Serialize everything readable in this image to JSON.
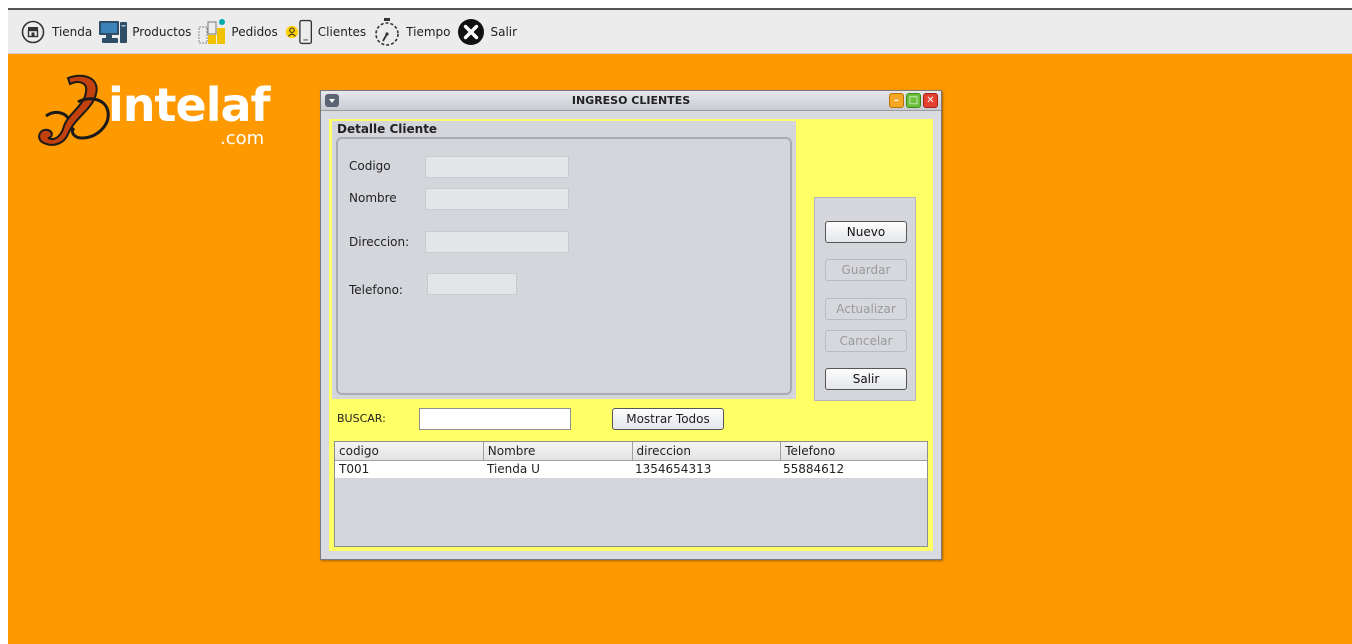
{
  "menu": {
    "items": [
      {
        "label": "Tienda",
        "icon": "store-icon"
      },
      {
        "label": "Productos",
        "icon": "computer-icon"
      },
      {
        "label": "Pedidos",
        "icon": "orders-icon"
      },
      {
        "label": "Clientes",
        "icon": "clients-icon"
      },
      {
        "label": "Tiempo",
        "icon": "stopwatch-icon"
      },
      {
        "label": "Salir",
        "icon": "exit-icon"
      }
    ]
  },
  "logo": {
    "word": "intelaf",
    "suffix": ".com"
  },
  "window": {
    "title": "INGRESO CLIENTES",
    "detalle": {
      "legend": "Detalle Cliente",
      "fields": {
        "codigo": {
          "label": "Codigo",
          "value": ""
        },
        "nombre": {
          "label": "Nombre",
          "value": ""
        },
        "direccion": {
          "label": "Direccion:",
          "value": ""
        },
        "telefono": {
          "label": "Telefono:",
          "value": ""
        }
      }
    },
    "buttons": {
      "nuevo": "Nuevo",
      "guardar": "Guardar",
      "actualizar": "Actualizar",
      "cancelar": "Cancelar",
      "salir": "Salir"
    },
    "search": {
      "label": "BUSCAR:",
      "value": "",
      "show_all": "Mostrar Todos"
    },
    "table": {
      "columns": [
        "codigo",
        "Nombre",
        "direccion",
        "Telefono"
      ],
      "rows": [
        [
          "T001",
          "Tienda U",
          "1354654313",
          "55884612"
        ]
      ]
    }
  },
  "colors": {
    "desktop": "#ff9900",
    "form_bg": "#ffff66",
    "panel": "#d4d6dc"
  }
}
